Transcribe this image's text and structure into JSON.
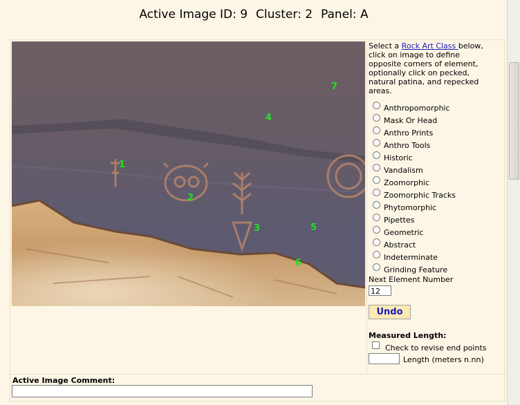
{
  "header": {
    "image_id": "Active Image ID: 9",
    "cluster": "Cluster: 2",
    "panel": "Panel: A"
  },
  "instructions": {
    "before": "Select a ",
    "link": "Rock Art Class ",
    "after": "below, click on image to define opposite corners of element, optionally click on pecked, natural patina, and repecked areas."
  },
  "classes": [
    "Anthropomorphic",
    "Mask Or Head",
    "Anthro Prints",
    "Anthro Tools",
    "Historic",
    "Vandalism",
    "Zoomorphic",
    "Zoomorphic Tracks",
    "Phytomorphic",
    "Pipettes",
    "Geometric",
    "Abstract",
    "Indeterminate",
    "Grinding Feature"
  ],
  "next_element": {
    "label": "Next Element Number",
    "value": "12"
  },
  "undo_label": "Undo",
  "measured": {
    "title": "Measured Length:",
    "checkbox_label": "Check to revise end points",
    "length_label": "Length (meters n.nn)",
    "length_value": ""
  },
  "comment": {
    "label": "Active Image Comment:",
    "value": ""
  },
  "markers": [
    "1",
    "2",
    "3",
    "4",
    "5",
    "6",
    "7"
  ],
  "colors": {
    "marker": "#22e222",
    "link": "#1a1ab8",
    "background": "#fdf6e6",
    "undo_bg": "#fbeab4"
  }
}
